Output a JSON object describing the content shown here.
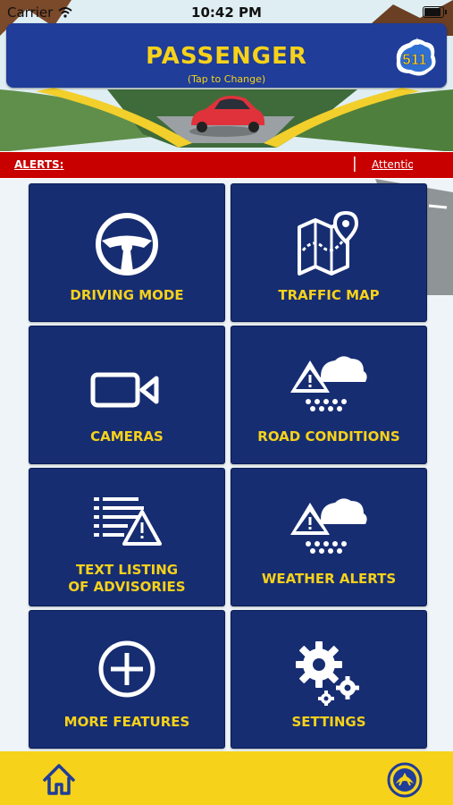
{
  "status_bar": {
    "carrier": "Carrier",
    "time": "10:42 PM",
    "wifi_icon": "wifi-icon",
    "battery_icon": "battery-icon"
  },
  "header": {
    "title": "PASSENGER",
    "subtitle": "(Tap to Change)",
    "logo_text": "511",
    "background_color": "#1f3d99",
    "text_color": "#f7d21a"
  },
  "alerts_bar": {
    "label": "ALERTS",
    "separator": "|",
    "ticker_text": "Attention",
    "background_color": "#c90000"
  },
  "tiles": [
    {
      "label": "DRIVING MODE",
      "icon": "steering-wheel-icon"
    },
    {
      "label": "TRAFFIC MAP",
      "icon": "map-pin-icon"
    },
    {
      "label": "CAMERAS",
      "icon": "video-camera-icon"
    },
    {
      "label": "ROAD CONDITIONS",
      "icon": "warning-snow-cloud-icon"
    },
    {
      "label": "TEXT LISTING",
      "label_line2": "OF ADVISORIES",
      "icon": "text-list-warning-icon"
    },
    {
      "label": "WEATHER ALERTS",
      "icon": "warning-snow-cloud-icon"
    },
    {
      "label": "MORE FEATURES",
      "icon": "plus-circle-icon"
    },
    {
      "label": "SETTINGS",
      "icon": "gears-icon"
    }
  ],
  "bottom_bar": {
    "home_icon": "home-icon",
    "seal_icon": "agency-seal-icon",
    "background_color": "#f7d21a"
  }
}
